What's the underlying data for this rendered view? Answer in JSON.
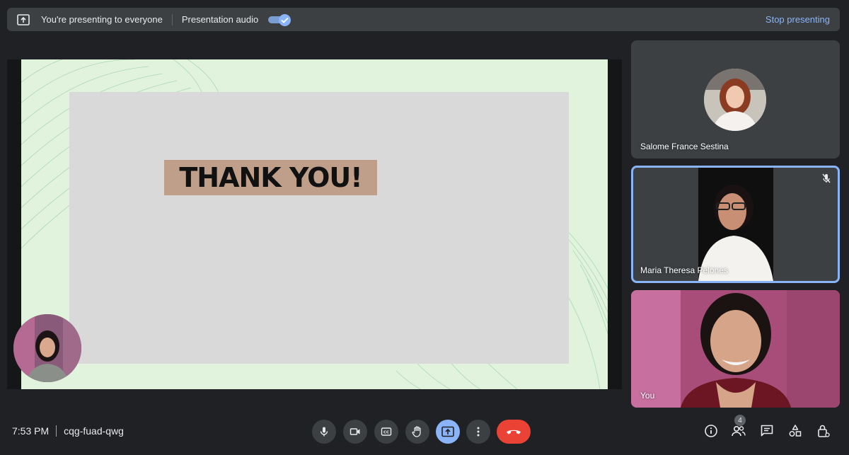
{
  "presenting_bar": {
    "status_text": "You're presenting to everyone",
    "audio_label": "Presentation audio",
    "audio_enabled": true,
    "stop_label": "Stop presenting"
  },
  "slide": {
    "headline": "THANK YOU!",
    "colors": {
      "background": "#e1f3dd",
      "panel": "#d9d9d9",
      "highlight": "#c09f8a"
    }
  },
  "participants": [
    {
      "name": "Salome France Sestina",
      "view": "avatar"
    },
    {
      "name": "Maria Theresa Pelones",
      "view": "video",
      "muted": true,
      "speaking_highlight": true
    },
    {
      "name": "You",
      "view": "video"
    }
  ],
  "meeting": {
    "time": "7:53 PM",
    "code": "cqg-fuad-qwg"
  },
  "controls": {
    "icons": [
      "mic-icon",
      "camera-icon",
      "captions-icon",
      "raise-hand-icon",
      "present-icon",
      "more-options-icon",
      "end-call-icon"
    ]
  },
  "side_controls": {
    "people_count": "4",
    "icons": [
      "info-icon",
      "people-icon",
      "chat-icon",
      "activities-icon",
      "host-controls-icon"
    ]
  },
  "colors": {
    "background": "#202124",
    "surface": "#3c4043",
    "accent": "#8ab4f8",
    "danger": "#ea4335"
  }
}
